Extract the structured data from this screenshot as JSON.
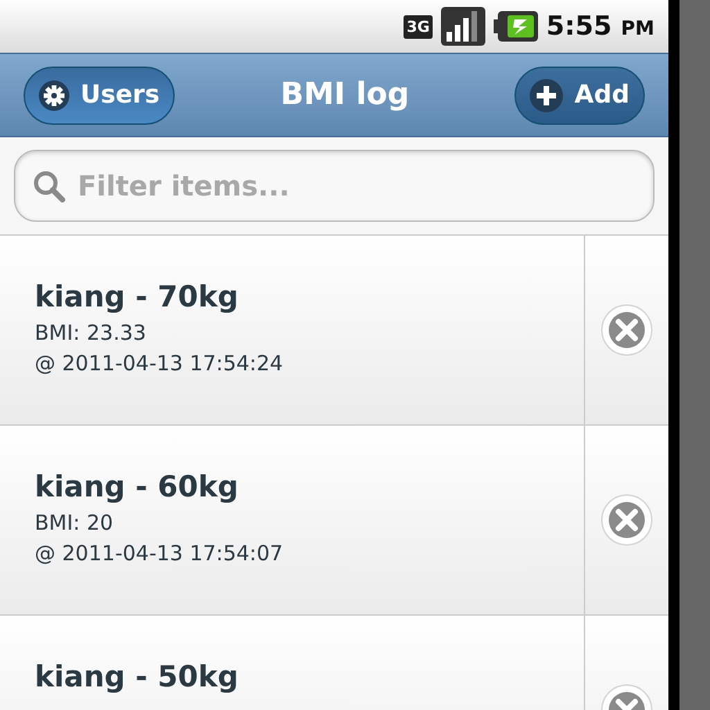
{
  "status_bar": {
    "network": "3G",
    "time": "5:55",
    "meridiem": "PM"
  },
  "header": {
    "title": "BMI log",
    "left_button": "Users",
    "right_button": "Add"
  },
  "search": {
    "placeholder": "Filter items..."
  },
  "entries": [
    {
      "title": "kiang - 70kg",
      "bmi": "BMI: 23.33",
      "timestamp": "@ 2011-04-13 17:54:24"
    },
    {
      "title": "kiang - 60kg",
      "bmi": "BMI: 20",
      "timestamp": "@ 2011-04-13 17:54:07"
    },
    {
      "title": "kiang - 50kg"
    }
  ]
}
